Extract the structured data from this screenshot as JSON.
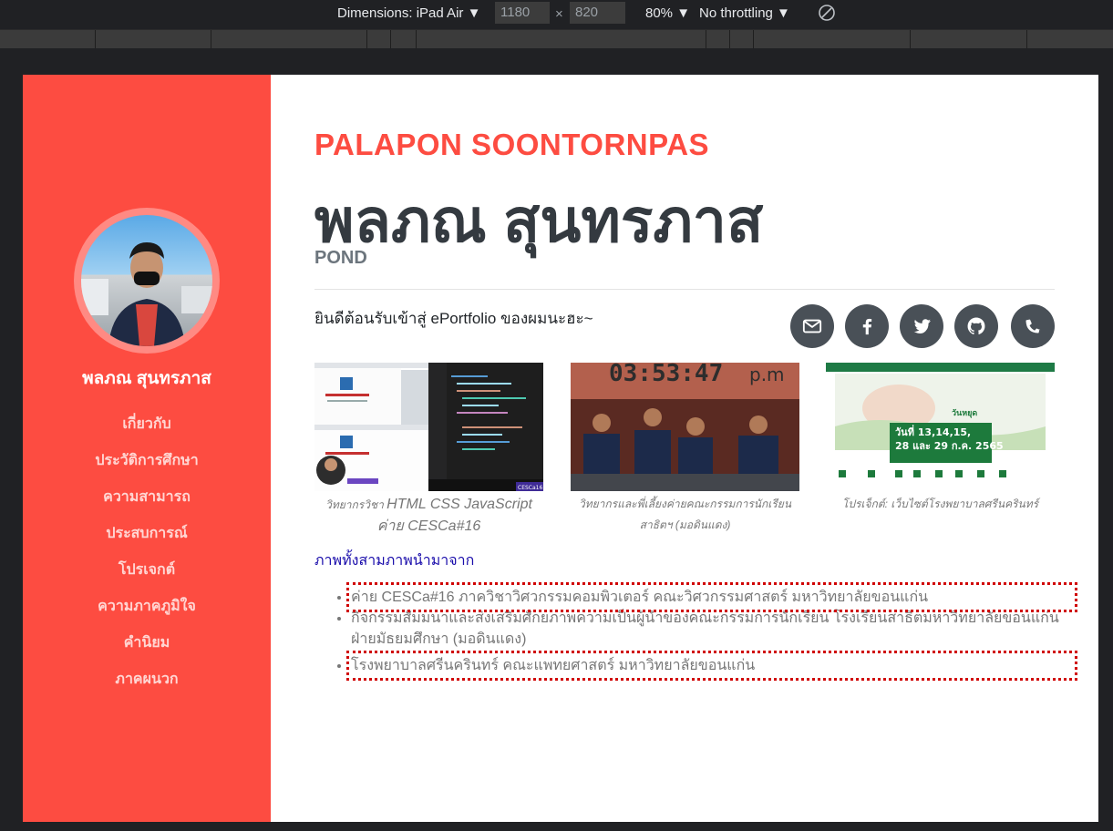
{
  "devtools": {
    "dimensions_label": "Dimensions: iPad Air",
    "width": "1180",
    "times": "×",
    "height": "820",
    "zoom": "80%",
    "throttle": "No throttling"
  },
  "sidebar": {
    "name": "พลภณ สุนทรภาส",
    "nav": [
      "เกี่ยวกับ",
      "ประวัติการศึกษา",
      "ความสามารถ",
      "ประสบการณ์",
      "โปรเจกต์",
      "ความภาคภูมิใจ",
      "คำนิยม",
      "ภาคผนวก"
    ]
  },
  "header": {
    "en_name": "PALAPON SOONTORNPAS",
    "th_name": "พลภณ สุนทรภาส",
    "nickname": "POND",
    "welcome": "ยินดีต้อนรับเข้าสู่ ePortfolio ของผมนะฮะ~"
  },
  "social_icons": [
    "envelope-icon",
    "facebook-icon",
    "twitter-icon",
    "github-icon",
    "phone-icon"
  ],
  "gallery": [
    {
      "caption_small": "วิทยากรวิชา",
      "caption_big": "HTML CSS JavaScript",
      "caption_line2": "ค่าย CESCa#16"
    },
    {
      "caption": "วิทยากรและพี่เลี้ยงค่ายคณะกรรมการนักเรียน สาธิตฯ (มอดินแดง)"
    },
    {
      "caption": "โปรเจ็กต์: เว็บไซต์โรงพยาบาลศรีนครินทร์"
    }
  ],
  "thumb_text": {
    "timer": "03:53:47",
    "timer_suffix": "p.m",
    "hospital_date1": "วันที่ 13,14,15,",
    "hospital_date2": "28 และ 29 ก.ค. 2565",
    "hospital_holiday": "วันหยุด",
    "cesca_badge": "CESCa16"
  },
  "sources": {
    "link": "ภาพทั้งสามภาพนำมาจาก",
    "items": [
      "ค่าย CESCa#16 ภาควิชาวิศวกรรมคอมพิวเตอร์ คณะวิศวกรรมศาสตร์ มหาวิทยาลัยขอนแก่น",
      "กิจกรรมสัมมนาและส่งเสริมศักยภาพความเป็นผู้นำของคณะกรรมการนักเรียน โรงเรียนสาธิตมหาวิทยาลัยขอนแก่น ฝ่ายมัธยมศึกษา (มอดินแดง)",
      "โรงพยาบาลศรีนครินทร์ คณะแพทยศาสตร์ มหาวิทยาลัยขอนแก่น"
    ]
  },
  "colors": {
    "accent": "#fd4c41",
    "dark": "#343a40",
    "icon_bg": "#495057",
    "highlight": "#d00000"
  }
}
